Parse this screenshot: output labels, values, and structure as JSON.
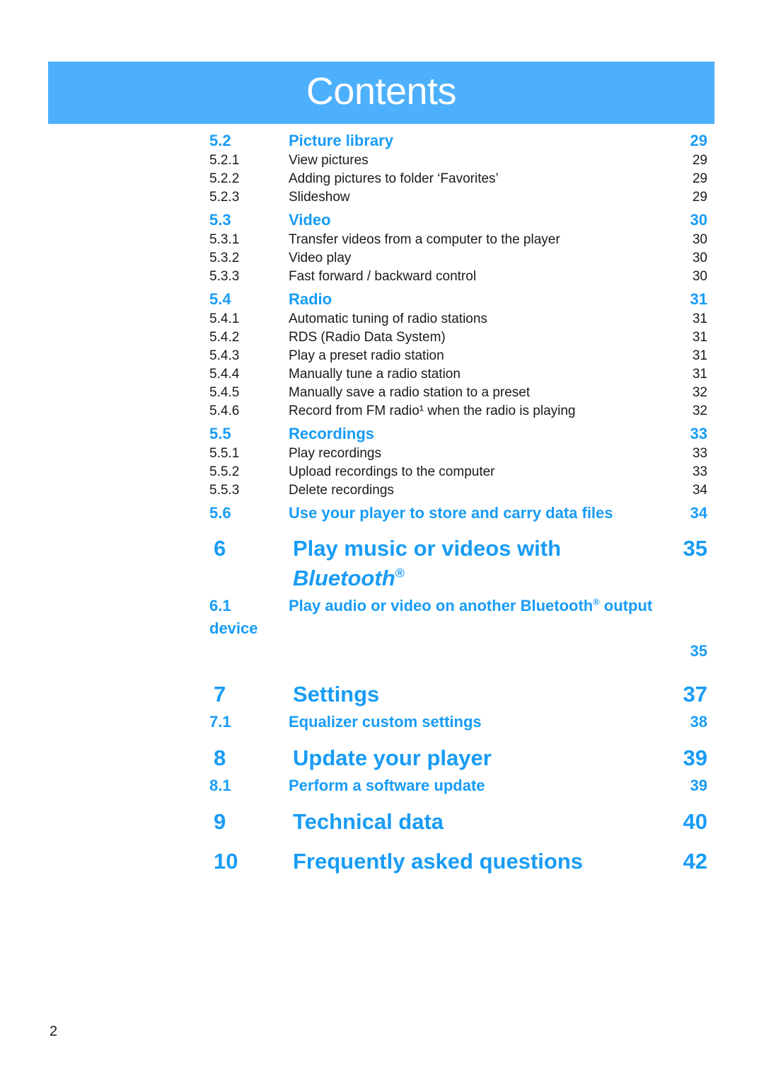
{
  "banner": {
    "title": "Contents"
  },
  "footer": {
    "page_number": "2"
  },
  "colors": {
    "banner_bg": "#4db0fc",
    "heading_blue": "#189cf5",
    "body_black": "#1a1a1a"
  },
  "toc": {
    "entries": [
      {
        "level": "section",
        "num": "5.2",
        "title": "Picture library",
        "page": "29"
      },
      {
        "level": "sub",
        "num": "5.2.1",
        "title": "View pictures",
        "page": "29"
      },
      {
        "level": "sub",
        "num": "5.2.2",
        "title": "Adding pictures to folder ‘Favorites’",
        "page": "29"
      },
      {
        "level": "sub",
        "num": "5.2.3",
        "title": "Slideshow",
        "page": "29"
      },
      {
        "level": "section",
        "num": "5.3",
        "title": "Video",
        "page": "30"
      },
      {
        "level": "sub",
        "num": "5.3.1",
        "title": "Transfer videos from a computer to the player",
        "page": "30"
      },
      {
        "level": "sub",
        "num": "5.3.2",
        "title": "Video play",
        "page": "30"
      },
      {
        "level": "sub",
        "num": "5.3.3",
        "title": "Fast forward / backward control",
        "page": "30"
      },
      {
        "level": "section",
        "num": "5.4",
        "title": "Radio",
        "page": "31"
      },
      {
        "level": "sub",
        "num": "5.4.1",
        "title": "Automatic tuning of radio stations",
        "page": "31"
      },
      {
        "level": "sub",
        "num": "5.4.2",
        "title": "RDS (Radio Data System)",
        "page": "31"
      },
      {
        "level": "sub",
        "num": "5.4.3",
        "title": "Play a preset radio station",
        "page": "31"
      },
      {
        "level": "sub",
        "num": "5.4.4",
        "title": "Manually tune a radio station",
        "page": "31"
      },
      {
        "level": "sub",
        "num": "5.4.5",
        "title": "Manually save a radio station to a preset",
        "page": "32"
      },
      {
        "level": "sub",
        "num": "5.4.6",
        "title": "Record from FM radio¹ when the radio is playing",
        "page": "32"
      },
      {
        "level": "section",
        "num": "5.5",
        "title": "Recordings",
        "page": "33"
      },
      {
        "level": "sub",
        "num": "5.5.1",
        "title": "Play recordings",
        "page": "33"
      },
      {
        "level": "sub",
        "num": "5.5.2",
        "title": "Upload recordings to the computer",
        "page": "33"
      },
      {
        "level": "sub",
        "num": "5.5.3",
        "title": "Delete recordings",
        "page": "34"
      },
      {
        "level": "section",
        "num": "5.6",
        "title": "Use your player to store and carry data files",
        "page": "34"
      },
      {
        "level": "chapter",
        "num": "6",
        "title": "Play music or videos with Bluetooth®",
        "page": "35"
      },
      {
        "level": "chaptersub",
        "num": "6.1",
        "title": "Play audio or video on another Bluetooth® output device",
        "page": "35"
      },
      {
        "level": "chapter",
        "num": "7",
        "title": "Settings",
        "page": "37"
      },
      {
        "level": "chaptersub",
        "num": "7.1",
        "title": "Equalizer custom settings",
        "page": "38"
      },
      {
        "level": "chapter",
        "num": "8",
        "title": "Update your player",
        "page": "39"
      },
      {
        "level": "chaptersub",
        "num": "8.1",
        "title": "Perform a software update",
        "page": "39"
      },
      {
        "level": "chapter",
        "num": "9",
        "title": "Technical data",
        "page": "40"
      },
      {
        "level": "chapter",
        "num": "10",
        "title": "Frequently asked questions",
        "page": "42"
      }
    ]
  }
}
